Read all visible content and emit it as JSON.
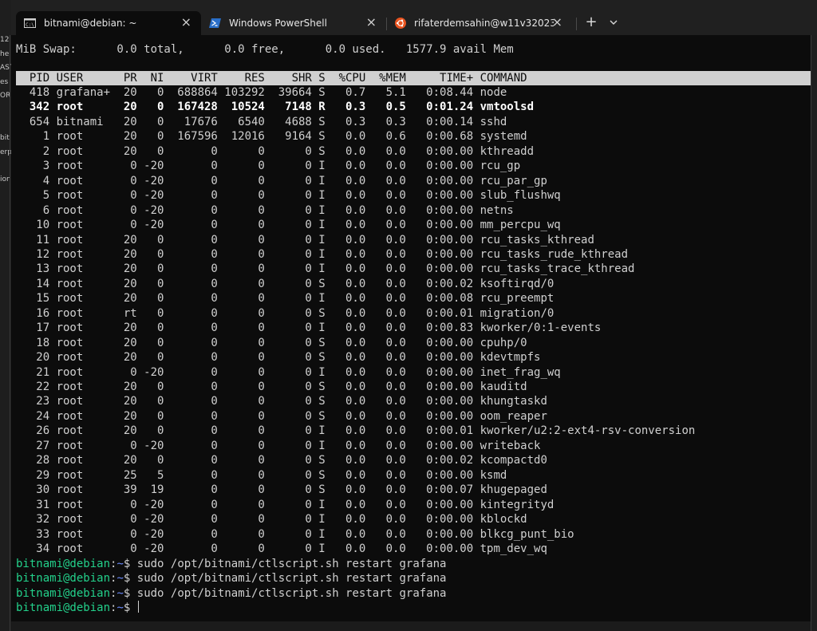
{
  "background_window": {
    "snippets": [
      "12",
      "he",
      "AST",
      "es",
      "ORI",
      "bit",
      "erp",
      "ion"
    ]
  },
  "tabs": [
    {
      "title": "bitnami@debian: ~",
      "icon": "cmd-terminal-icon",
      "active": true
    },
    {
      "title": "Windows PowerShell",
      "icon": "powershell-icon",
      "active": false
    },
    {
      "title": "rifaterdemsahin@w11v3202372",
      "icon": "ubuntu-icon",
      "active": false
    }
  ],
  "tab_controls": {
    "new_tab": "+",
    "close": "×"
  },
  "terminal": {
    "swap_line": "MiB Swap:      0.0 total,      0.0 free,      0.0 used.   1577.9 avail Mem",
    "header": "  PID USER      PR  NI    VIRT    RES    SHR S  %CPU  %MEM     TIME+ COMMAND",
    "processes": [
      "  418 grafana+  20   0  688864 103292  39664 S   0.7   5.1   0:08.44 node",
      "  342 root      20   0  167428  10524   7148 R   0.3   0.5   0:01.24 vmtoolsd",
      "  654 bitnami   20   0   17676   6540   4688 S   0.3   0.3   0:00.14 sshd",
      "    1 root      20   0  167596  12016   9164 S   0.0   0.6   0:00.68 systemd",
      "    2 root      20   0       0      0      0 S   0.0   0.0   0:00.00 kthreadd",
      "    3 root       0 -20       0      0      0 I   0.0   0.0   0:00.00 rcu_gp",
      "    4 root       0 -20       0      0      0 I   0.0   0.0   0:00.00 rcu_par_gp",
      "    5 root       0 -20       0      0      0 I   0.0   0.0   0:00.00 slub_flushwq",
      "    6 root       0 -20       0      0      0 I   0.0   0.0   0:00.00 netns",
      "   10 root       0 -20       0      0      0 I   0.0   0.0   0:00.00 mm_percpu_wq",
      "   11 root      20   0       0      0      0 I   0.0   0.0   0:00.00 rcu_tasks_kthread",
      "   12 root      20   0       0      0      0 I   0.0   0.0   0:00.00 rcu_tasks_rude_kthread",
      "   13 root      20   0       0      0      0 I   0.0   0.0   0:00.00 rcu_tasks_trace_kthread",
      "   14 root      20   0       0      0      0 S   0.0   0.0   0:00.02 ksoftirqd/0",
      "   15 root      20   0       0      0      0 I   0.0   0.0   0:00.08 rcu_preempt",
      "   16 root      rt   0       0      0      0 S   0.0   0.0   0:00.01 migration/0",
      "   17 root      20   0       0      0      0 I   0.0   0.0   0:00.83 kworker/0:1-events",
      "   18 root      20   0       0      0      0 S   0.0   0.0   0:00.00 cpuhp/0",
      "   20 root      20   0       0      0      0 S   0.0   0.0   0:00.00 kdevtmpfs",
      "   21 root       0 -20       0      0      0 I   0.0   0.0   0:00.00 inet_frag_wq",
      "   22 root      20   0       0      0      0 S   0.0   0.0   0:00.00 kauditd",
      "   23 root      20   0       0      0      0 S   0.0   0.0   0:00.00 khungtaskd",
      "   24 root      20   0       0      0      0 S   0.0   0.0   0:00.00 oom_reaper",
      "   26 root      20   0       0      0      0 I   0.0   0.0   0:00.01 kworker/u2:2-ext4-rsv-conversion",
      "   27 root       0 -20       0      0      0 I   0.0   0.0   0:00.00 writeback",
      "   28 root      20   0       0      0      0 S   0.0   0.0   0:00.02 kcompactd0",
      "   29 root      25   5       0      0      0 S   0.0   0.0   0:00.00 ksmd",
      "   30 root      39  19       0      0      0 S   0.0   0.0   0:00.07 khugepaged",
      "   31 root       0 -20       0      0      0 I   0.0   0.0   0:00.00 kintegrityd",
      "   32 root       0 -20       0      0      0 I   0.0   0.0   0:00.00 kblockd",
      "   33 root       0 -20       0      0      0 I   0.0   0.0   0:00.00 blkcg_punt_bio",
      "   34 root       0 -20       0      0      0 I   0.0   0.0   0:00.00 tpm_dev_wq"
    ],
    "prompt": {
      "user_host": "bitnami@debian",
      "path": "~",
      "symbol": "$"
    },
    "commands": [
      "sudo /opt/bitnami/ctlscript.sh restart grafana",
      "sudo /opt/bitnami/ctlscript.sh restart grafana",
      "sudo /opt/bitnami/ctlscript.sh restart grafana",
      ""
    ],
    "colors": {
      "background": "#0c0c0c",
      "foreground": "#d0d0d0",
      "prompt_user": "#23d18b",
      "prompt_path": "#6b8cff"
    }
  }
}
